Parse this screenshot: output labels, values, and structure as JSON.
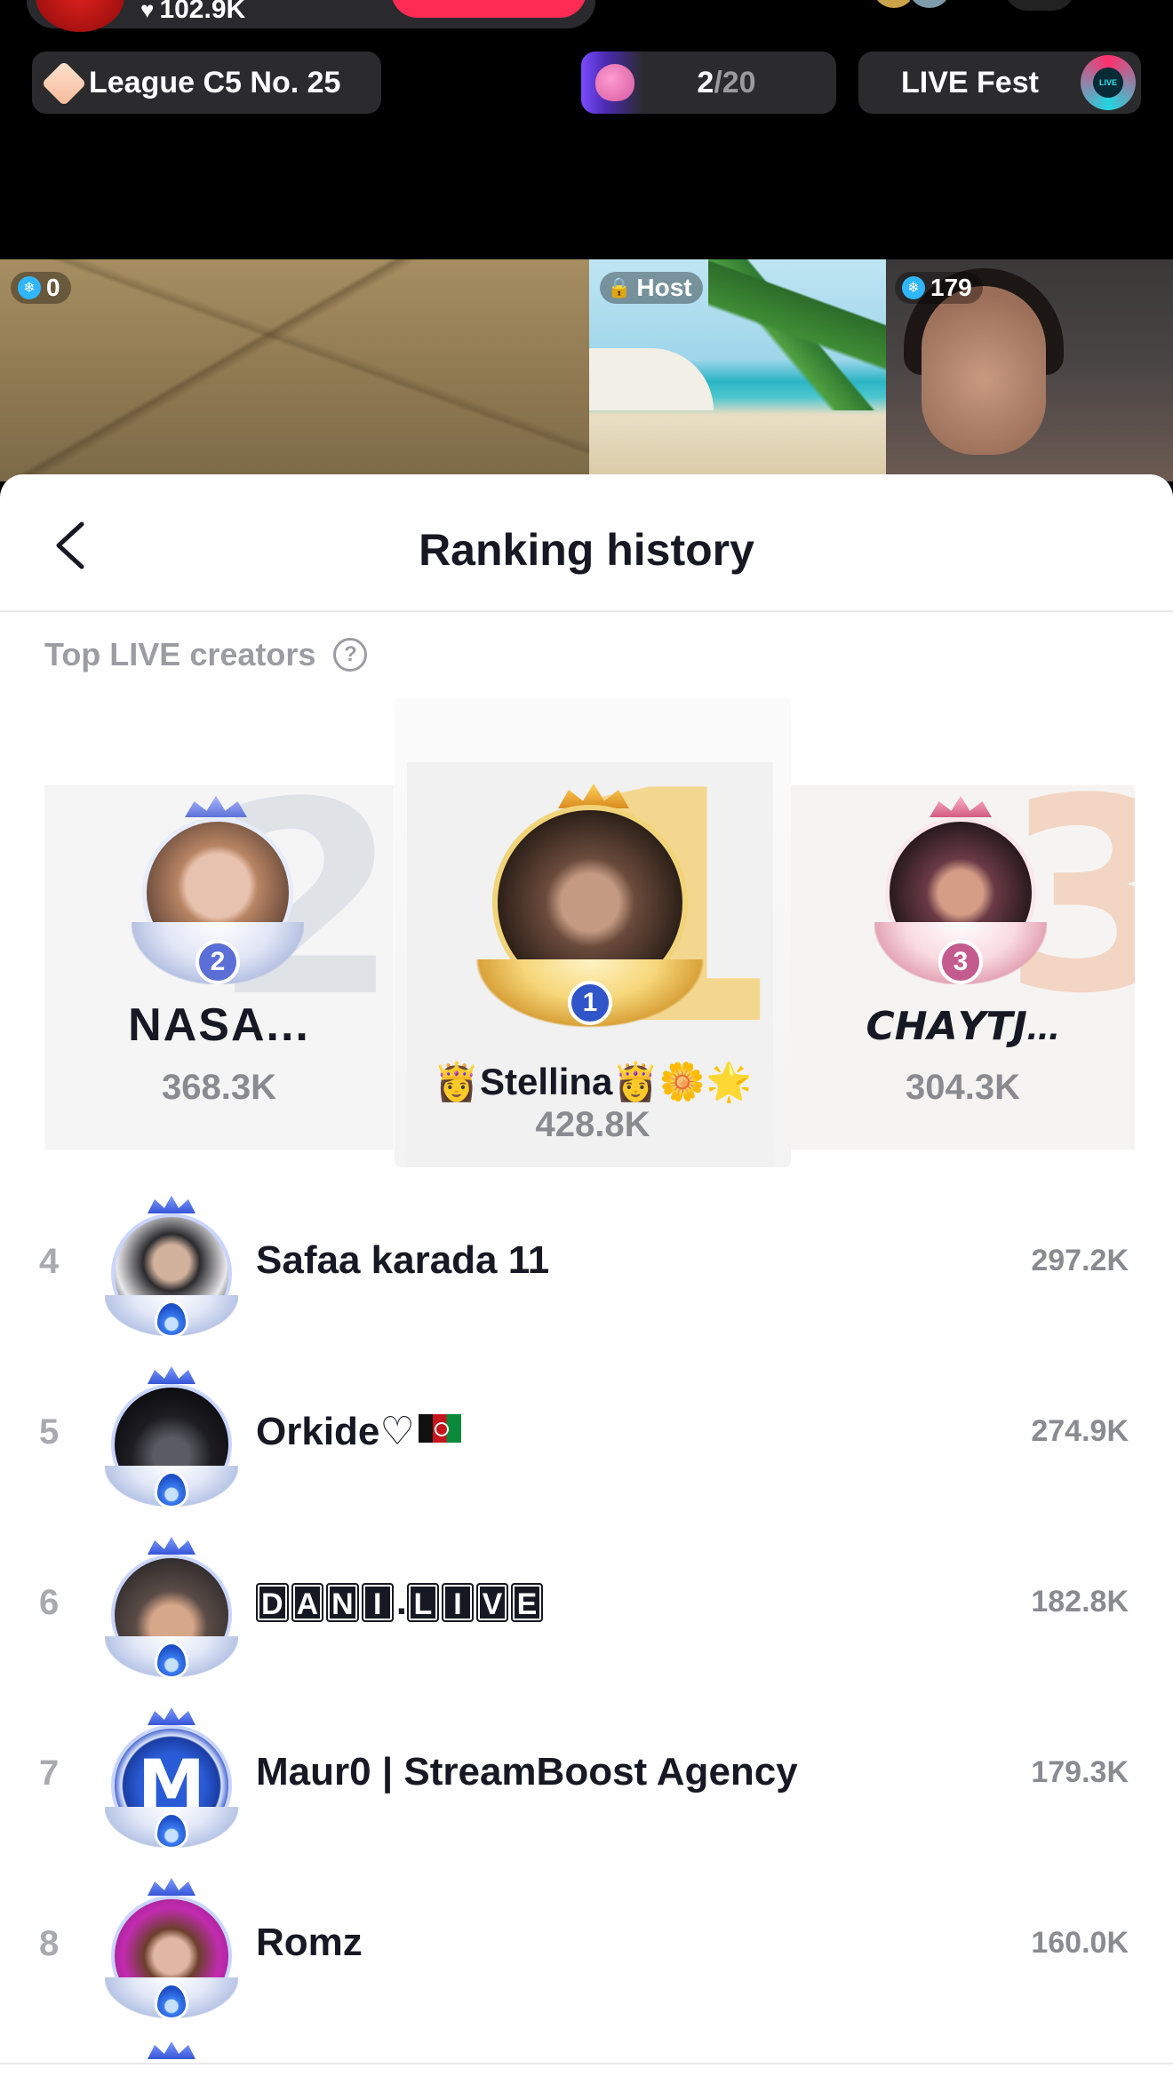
{
  "live": {
    "likes": "102.9K",
    "league": "League C5 No. 25",
    "progress_current": "2",
    "progress_total": "/20",
    "fest_label": "LIVE Fest",
    "fest_badge": "LIVE"
  },
  "tiles": [
    {
      "tag": "0"
    },
    {
      "tag": "Host"
    },
    {
      "tag": "179"
    }
  ],
  "sheet": {
    "title": "Ranking history",
    "section_label": "Top LIVE creators",
    "help_icon": "?"
  },
  "podium": [
    {
      "rank": "2",
      "name": "NASA...",
      "score": "368.3K",
      "big_num": "2",
      "accent": "#5c6fd6"
    },
    {
      "rank": "1",
      "name": "👸Stellina👸🌼🌟",
      "score": "428.8K",
      "big_num": "1",
      "accent": "#2f55c9"
    },
    {
      "rank": "3",
      "name": "𝘾𝙃𝘼𝙔𝙏𝙅...",
      "score": "304.3K",
      "big_num": "3",
      "accent": "#c45b8f"
    }
  ],
  "rankings": [
    {
      "rank": "4",
      "name": "Safaa karada 11",
      "score": "297.2K"
    },
    {
      "rank": "5",
      "name": "Orkide♡",
      "score": "274.9K"
    },
    {
      "rank": "6",
      "name": "DANI.LIVE",
      "score": "182.8K"
    },
    {
      "rank": "7",
      "name": "Maur0 | StreamBoost Agency",
      "score": "179.3K"
    },
    {
      "rank": "8",
      "name": "Romz",
      "score": "160.0K"
    }
  ],
  "icons": {
    "back": "chevron-left-icon",
    "help": "question-circle-icon",
    "heart": "heart-icon",
    "gem": "gem-icon"
  }
}
